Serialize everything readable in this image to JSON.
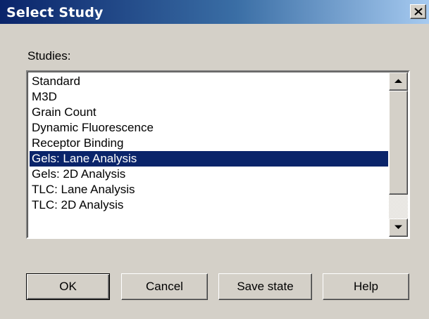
{
  "window": {
    "title": "Select Study",
    "close_glyph": "close-icon"
  },
  "studies": {
    "label": "Studies:",
    "items": [
      "Standard",
      "M3D",
      "Grain Count",
      "Dynamic Fluorescence",
      "Receptor Binding",
      "Gels: Lane Analysis",
      "Gels: 2D Analysis",
      "TLC: Lane Analysis",
      "TLC: 2D Analysis"
    ],
    "selected": "Gels: Lane Analysis"
  },
  "buttons": {
    "ok": "OK",
    "cancel": "Cancel",
    "save_state": "Save state",
    "help": "Help"
  },
  "colors": {
    "dialog_face": "#d4d0c8",
    "title_bar_start": "#0a246a",
    "title_bar_end": "#a6caf0",
    "selection": "#0a246a"
  }
}
